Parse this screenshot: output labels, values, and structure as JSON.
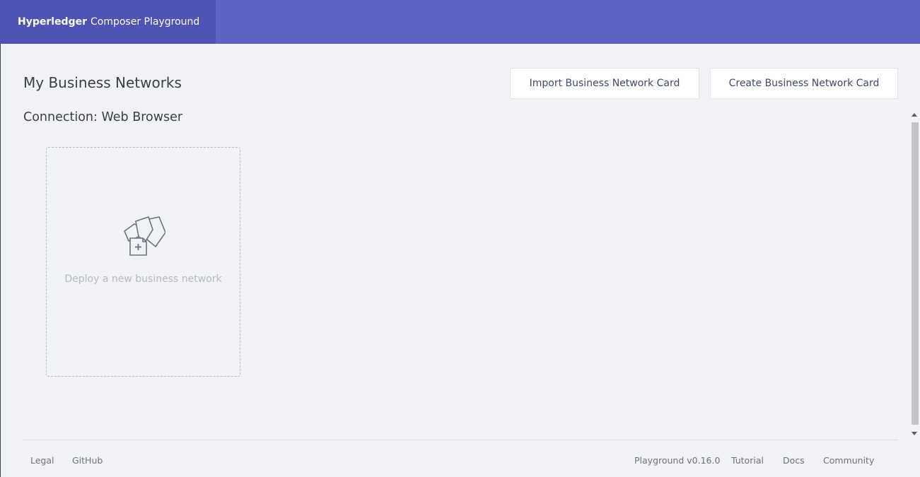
{
  "header": {
    "brand_bold": "Hyperledger",
    "brand_rest": "Composer Playground",
    "bar_color": "#5b62c2",
    "brand_bg_color": "#4d54b3"
  },
  "main": {
    "title": "My Business Networks",
    "connection_label": "Connection: Web Browser",
    "import_button_label": "Import Business Network Card",
    "create_button_label": "Create Business Network Card",
    "deploy_card": {
      "icon": "deploy-network-icon",
      "label": "Deploy a new business network"
    }
  },
  "footer": {
    "left_links": [
      "Legal",
      "GitHub"
    ],
    "version": "Playground v0.16.0",
    "right_links": [
      "Tutorial",
      "Docs",
      "Community"
    ]
  }
}
